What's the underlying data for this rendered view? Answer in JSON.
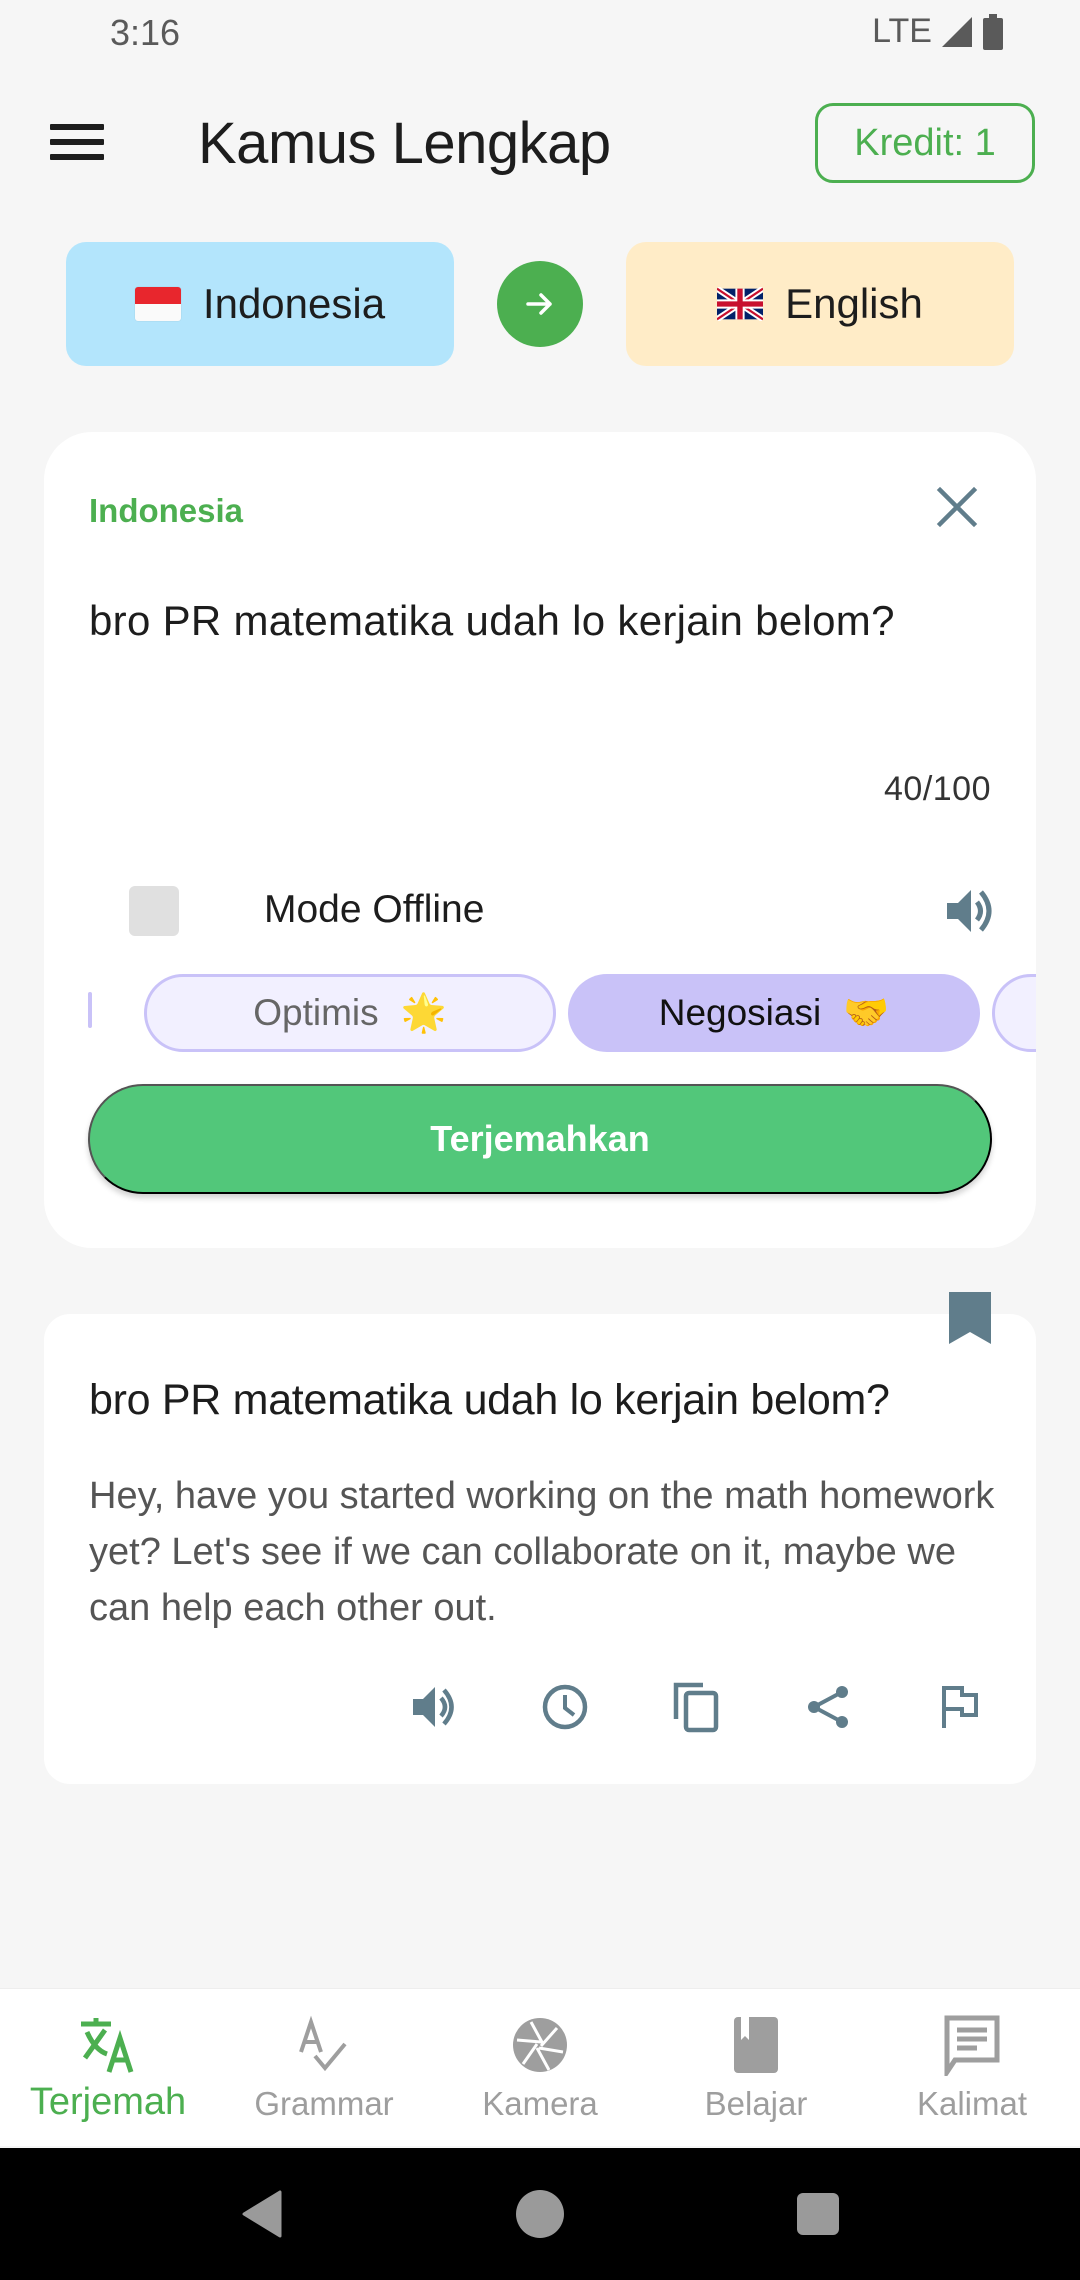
{
  "status_bar": {
    "time": "3:16",
    "network": "LTE"
  },
  "app_bar": {
    "title": "Kamus Lengkap",
    "credit_label": "Kredit: 1",
    "menu_icon": "hamburger-menu-icon"
  },
  "languages": {
    "source": {
      "name": "Indonesia",
      "flag": "indonesia-flag",
      "bg": "#b3e5fc"
    },
    "target": {
      "name": "English",
      "flag": "uk-flag",
      "bg": "#ffecc7"
    },
    "swap_icon": "arrow-right-icon"
  },
  "input_card": {
    "source_label": "Indonesia",
    "text": "bro PR matematika udah lo kerjain belom?",
    "char_count": "40/100",
    "offline_label": "Mode Offline",
    "offline_checked": false,
    "tone_chips": [
      {
        "label": "Optimis",
        "emoji": "🌟",
        "selected": false
      },
      {
        "label": "Negosiasi",
        "emoji": "🤝",
        "selected": true
      }
    ],
    "translate_label": "Terjemahkan"
  },
  "result_card": {
    "source_text": "bro PR matematika udah lo kerjain belom?",
    "translated_text": "Hey, have you started working on the math homework yet?  Let's see if we can collaborate on it, maybe we can help each other out.",
    "actions": [
      "speaker-icon",
      "history-icon",
      "copy-icon",
      "share-icon",
      "flag-report-icon"
    ]
  },
  "bottom_nav": {
    "items": [
      {
        "label": "Terjemah",
        "icon": "translate-icon",
        "active": true
      },
      {
        "label": "Grammar",
        "icon": "spellcheck-icon",
        "active": false
      },
      {
        "label": "Kamera",
        "icon": "camera-shutter-icon",
        "active": false
      },
      {
        "label": "Belajar",
        "icon": "book-icon",
        "active": false
      },
      {
        "label": "Kalimat",
        "icon": "chat-bubble-icon",
        "active": false
      }
    ]
  },
  "colors": {
    "accent": "#4caf50",
    "translate_button": "#52c77a",
    "chip_selected": "#c9c2f8",
    "chip_unselected": "#f2f0ff",
    "icon_gray": "#607d8b",
    "nav_inactive": "#9e9e9e"
  }
}
